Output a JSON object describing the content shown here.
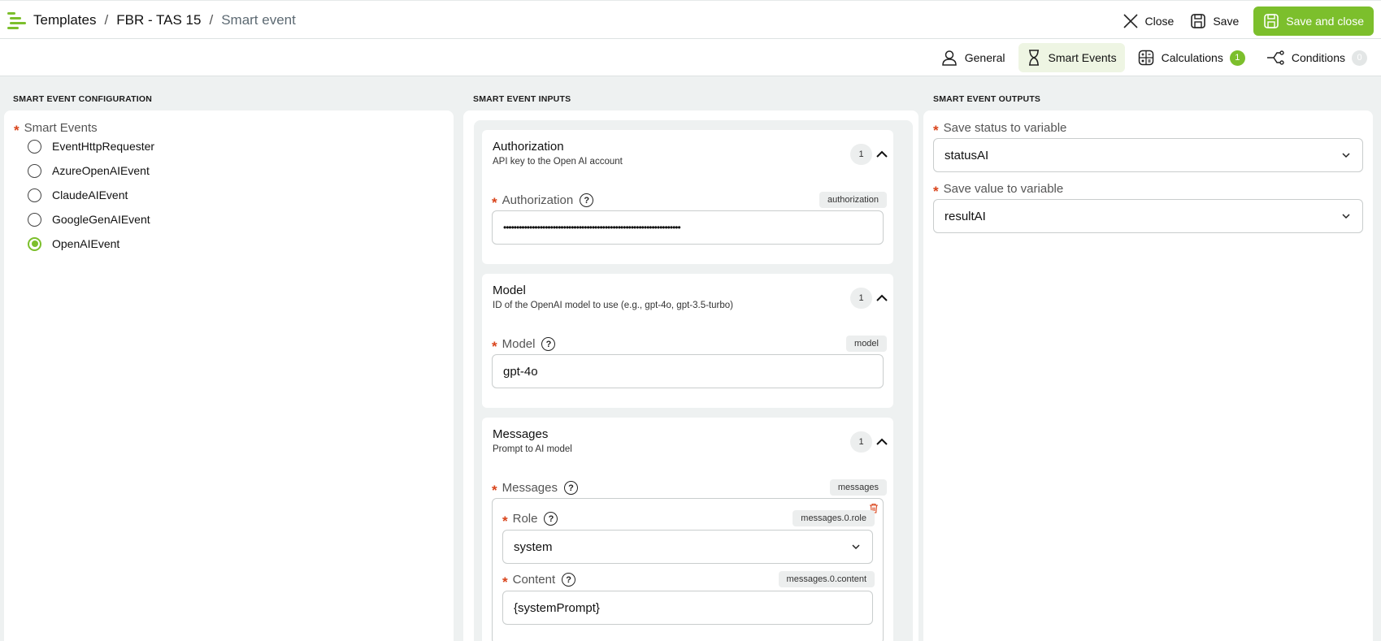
{
  "breadcrumb": [
    "Templates",
    "FBR - TAS 15",
    "Smart event"
  ],
  "breadcrumb_separator": "/",
  "actions": {
    "close": "Close",
    "save": "Save",
    "save_close": "Save and close"
  },
  "tabs": [
    {
      "label": "General",
      "icon": "user-icon"
    },
    {
      "label": "Smart Events",
      "icon": "hourglass-icon",
      "active": true
    },
    {
      "label": "Calculations",
      "icon": "calculator-icon",
      "badge": "1"
    },
    {
      "label": "Conditions",
      "icon": "branch-icon",
      "badge": "0"
    }
  ],
  "config": {
    "title": "SMART EVENT CONFIGURATION",
    "label": "Smart Events",
    "options": [
      "EventHttpRequester",
      "AzureOpenAIEvent",
      "ClaudeAIEvent",
      "GoogleGenAIEvent",
      "OpenAIEvent"
    ],
    "selected": "OpenAIEvent"
  },
  "inputs": {
    "title": "SMART EVENT INPUTS",
    "authorization": {
      "title": "Authorization",
      "subtitle": "API key to the Open AI account",
      "count": "1",
      "field_label": "Authorization",
      "key": "authorization",
      "value": "••••••••••••••••••••••••••••••••••••••••••••••••••••••••••••••••••••"
    },
    "model": {
      "title": "Model",
      "subtitle": "ID of the OpenAI model to use (e.g., gpt-4o, gpt-3.5-turbo)",
      "count": "1",
      "field_label": "Model",
      "key": "model",
      "value": "gpt-4o"
    },
    "messages": {
      "title": "Messages",
      "subtitle": "Prompt to AI model",
      "count": "1",
      "field_label": "Messages",
      "key": "messages",
      "role_label": "Role",
      "role_key": "messages.0.role",
      "role_value": "system",
      "content_label": "Content",
      "content_key": "messages.0.content",
      "content_value": "{systemPrompt}"
    }
  },
  "outputs": {
    "title": "SMART EVENT OUTPUTS",
    "status_label": "Save status to variable",
    "status_value": "statusAI",
    "value_label": "Save value to variable",
    "value_value": "resultAI"
  },
  "colors": {
    "accent": "#7cbf2c",
    "required": "#d9441b",
    "background": "#eef1f1"
  }
}
